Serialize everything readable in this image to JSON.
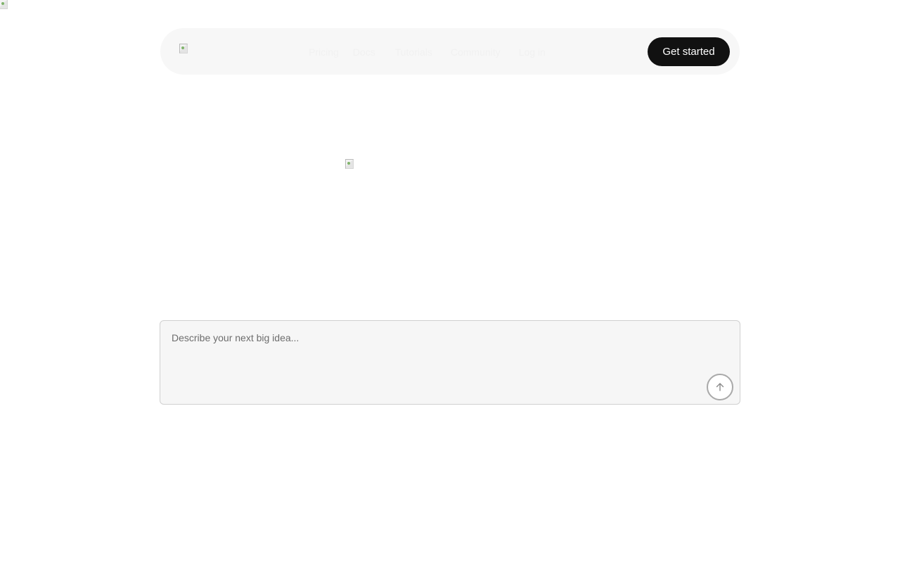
{
  "header": {
    "nav_links": [
      {
        "label": "Pricing"
      },
      {
        "label": "Docs"
      },
      {
        "label": "Tutorials"
      },
      {
        "label": "Community"
      },
      {
        "label": "Log in"
      }
    ],
    "cta_label": "Get started"
  },
  "prompt": {
    "placeholder": "Describe your next big idea...",
    "submit_icon": "arrow-up-icon"
  },
  "colors": {
    "cta_background": "#111111",
    "prompt_background": "#f6f6f6"
  }
}
